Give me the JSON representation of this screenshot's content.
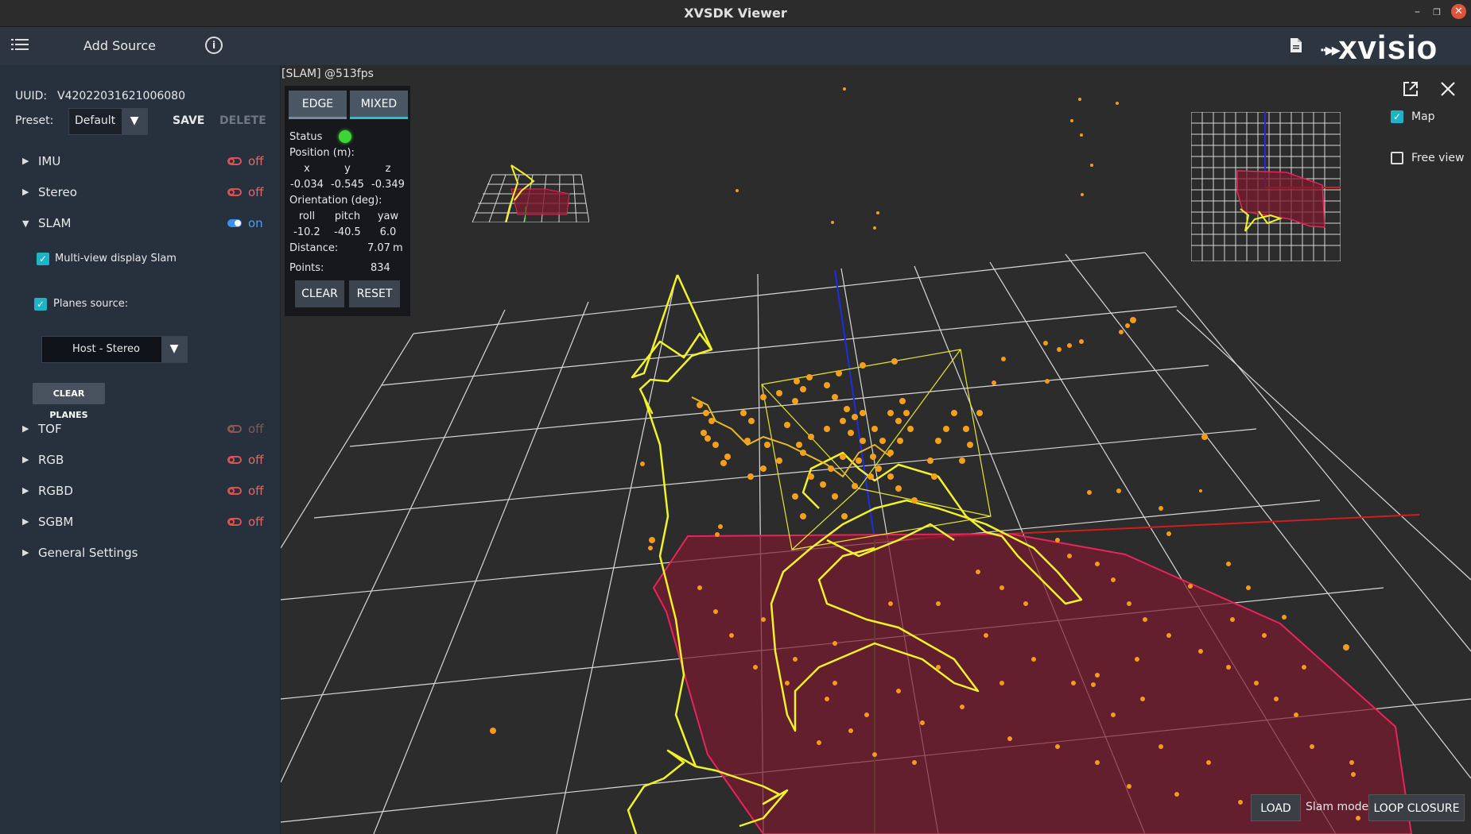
{
  "window": {
    "title": "XVSDK Viewer"
  },
  "toolbar": {
    "add_source": "Add Source",
    "logo": "xvisio"
  },
  "sidebar": {
    "uuid_label": "UUID:",
    "uuid_value": "V42022031621006080",
    "preset_label": "Preset:",
    "preset_value": "Default",
    "save": "SAVE",
    "delete": "DELETE",
    "items": [
      {
        "label": "IMU",
        "state": "off"
      },
      {
        "label": "Stereo",
        "state": "off"
      },
      {
        "label": "SLAM",
        "state": "on"
      },
      {
        "label": "TOF",
        "state": "off"
      },
      {
        "label": "RGB",
        "state": "off"
      },
      {
        "label": "RGBD",
        "state": "off"
      },
      {
        "label": "SGBM",
        "state": "off"
      },
      {
        "label": "General Settings"
      }
    ],
    "slam": {
      "multi_view": "Multi-view display Slam",
      "planes_source": "Planes source:",
      "planes_value": "Host - Stereo",
      "clear_planes": "CLEAR PLANES"
    }
  },
  "viewport": {
    "label": "[SLAM]  @513fps",
    "map_label": "Map",
    "map_checked": true,
    "free_view_label": "Free view",
    "free_view_checked": false
  },
  "hud": {
    "edge": "EDGE",
    "mixed": "MIXED",
    "status_label": "Status",
    "position_label": "Position (m):",
    "pos_headers": [
      "x",
      "y",
      "z"
    ],
    "pos_values": [
      "-0.034",
      "-0.545",
      "-0.349"
    ],
    "orientation_label": "Orientation (deg):",
    "ori_headers": [
      "roll",
      "pitch",
      "yaw"
    ],
    "ori_values": [
      "-10.2",
      "-40.5",
      "6.0"
    ],
    "distance_label": "Distance:",
    "distance_value": "7.07",
    "distance_unit": "m",
    "points_label": "Points:",
    "points_value": "834",
    "clear": "CLEAR",
    "reset": "RESET"
  },
  "bottom": {
    "load": "LOAD",
    "slam_mode": "Slam mode",
    "loop_closure": "LOOP CLOSURE"
  },
  "colors": {
    "accent": "#1fc4cf",
    "off": "#e56760",
    "on": "#4c9ef0",
    "plane": "#8b1c2e",
    "trajectory": "#f2f22a",
    "points": "#f59a1a"
  }
}
